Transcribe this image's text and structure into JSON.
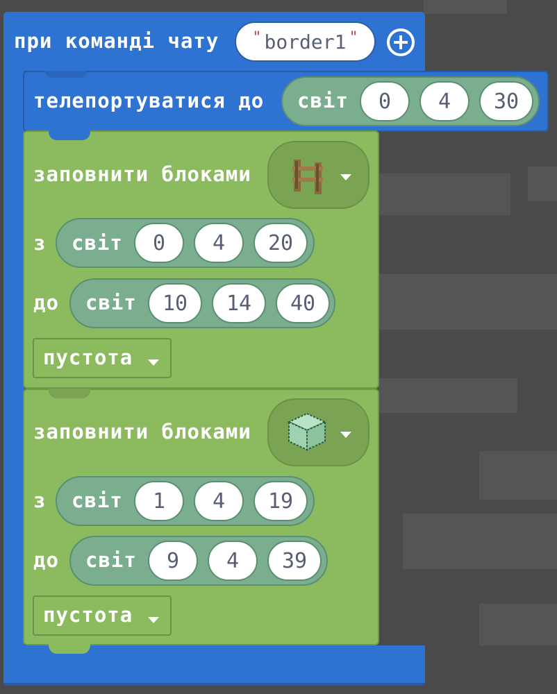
{
  "event_block": {
    "label": "при команді чату",
    "command_value": "border1",
    "add_icon": "plus-circle-icon",
    "color": "#2f73d2"
  },
  "teleport_block": {
    "label": "телепортуватися до",
    "position": {
      "label": "світ",
      "x": "0",
      "y": "4",
      "z": "30"
    }
  },
  "fill_blocks": [
    {
      "label": "заповнити блоками",
      "block_icon": "oak-fence-icon",
      "from_label": "з",
      "from": {
        "label": "світ",
        "x": "0",
        "y": "4",
        "z": "20"
      },
      "to_label": "до",
      "to": {
        "label": "світ",
        "x": "10",
        "y": "14",
        "z": "40"
      },
      "mode": "пустота",
      "color": "#8cbb5f"
    },
    {
      "label": "заповнити блоками",
      "block_icon": "glass-block-icon",
      "from_label": "з",
      "from": {
        "label": "світ",
        "x": "1",
        "y": "4",
        "z": "19"
      },
      "to_label": "до",
      "to": {
        "label": "світ",
        "x": "9",
        "y": "4",
        "z": "39"
      },
      "mode": "пустота",
      "color": "#8cbb5f"
    }
  ]
}
